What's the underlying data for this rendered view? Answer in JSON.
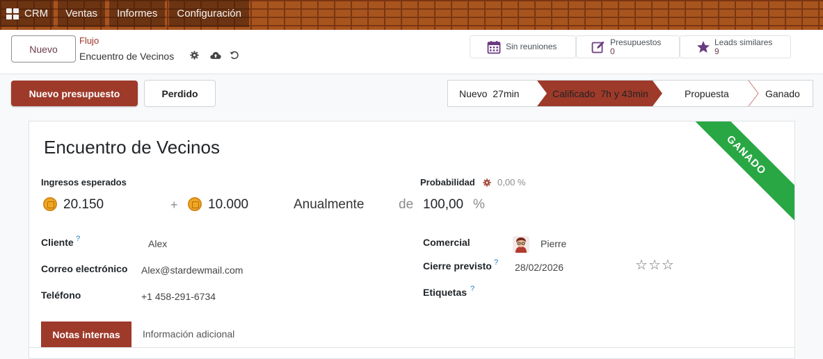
{
  "nav": {
    "app_name": "CRM",
    "menu": [
      "Ventas",
      "Informes",
      "Configuración"
    ]
  },
  "control": {
    "new_label": "Nuevo",
    "breadcrumb": "Flujo",
    "record_title": "Encuentro de Vecinos",
    "stats": [
      {
        "label": "Sin reuniones",
        "value": ""
      },
      {
        "label": "Presupuestos",
        "value": "0"
      },
      {
        "label": "Leads similares",
        "value": "9"
      }
    ]
  },
  "actions": {
    "primary": "Nuevo presupuesto",
    "secondary": "Perdido"
  },
  "stages": [
    {
      "name": "Nuevo",
      "time": "27min"
    },
    {
      "name": "Calificado",
      "time": "7h y 43min"
    },
    {
      "name": "Propuesta",
      "time": ""
    },
    {
      "name": "Ganado",
      "time": ""
    }
  ],
  "form": {
    "ribbon": "GANADO",
    "name": "Encuentro de Vecinos",
    "revenue_label": "Ingresos esperados",
    "revenue": "20.150",
    "plus": "+",
    "recurring": "10.000",
    "recurring_plan": "Anualmente",
    "de": "de",
    "probability_label": "Probabilidad",
    "probability_auto": "0,00 %",
    "probability": "100,00",
    "percent": "%",
    "customer_label": "Cliente",
    "customer": "Alex",
    "email_label": "Correo electrónico",
    "email": "Alex@stardewmail.com",
    "phone_label": "Teléfono",
    "phone": "+1 458-291-6734",
    "salesperson_label": "Comercial",
    "salesperson": "Pierre",
    "deadline_label": "Cierre previsto",
    "deadline": "28/02/2026",
    "tags_label": "Etiquetas",
    "priority_stars": 0,
    "help_mark": "?"
  },
  "tabs": [
    "Notas internas",
    "Información adicional"
  ]
}
